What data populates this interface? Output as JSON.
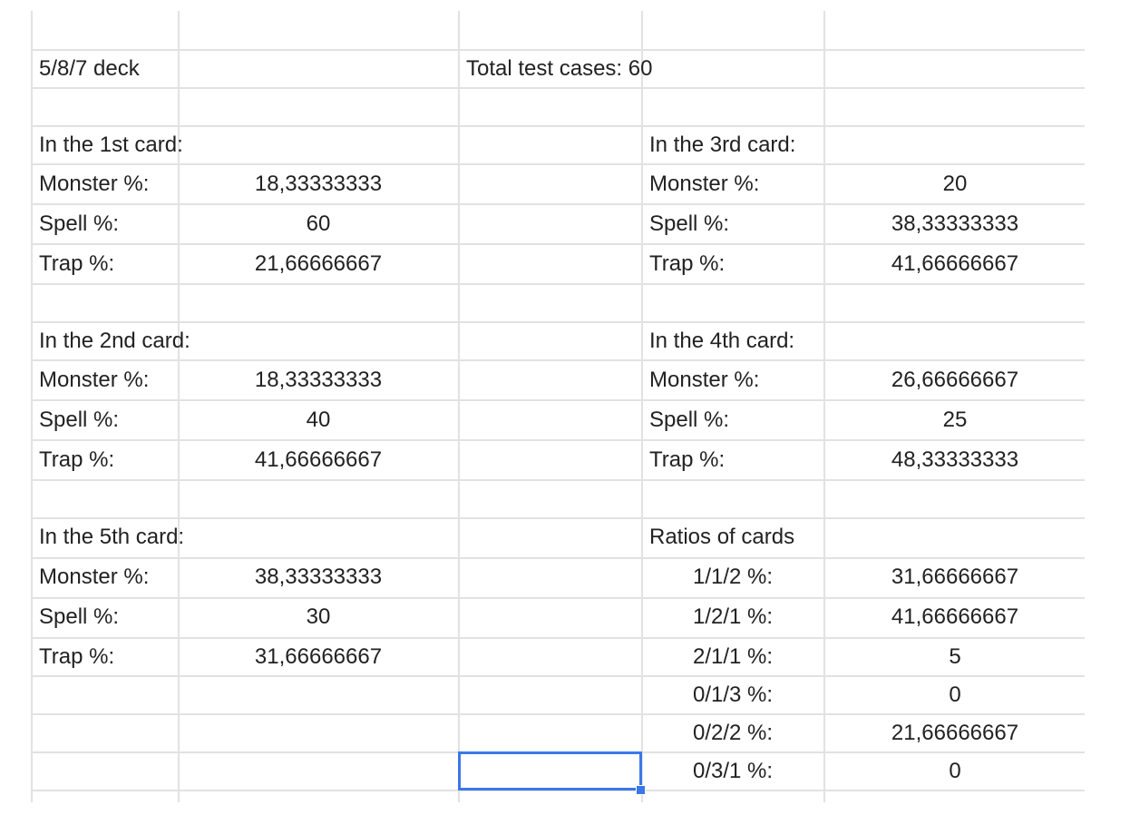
{
  "sheet": {
    "title": "5/8/7 deck",
    "total_test_cases": "Total test cases: 60",
    "labels": {
      "monster": "Monster %:",
      "spell": "Spell %:",
      "trap": "Trap %:"
    },
    "card1": {
      "heading": "In the 1st card:",
      "monster": "18,33333333",
      "spell": "60",
      "trap": "21,66666667"
    },
    "card2": {
      "heading": "In the 2nd card:",
      "monster": "18,33333333",
      "spell": "40",
      "trap": "41,66666667"
    },
    "card3": {
      "heading": "In the 3rd card:",
      "monster": "20",
      "spell": "38,33333333",
      "trap": "41,66666667"
    },
    "card4": {
      "heading": "In the 4th card:",
      "monster": "26,66666667",
      "spell": "25",
      "trap": "48,33333333"
    },
    "card5": {
      "heading": "In the 5th card:",
      "monster": "38,33333333",
      "spell": "30",
      "trap": "31,66666667"
    },
    "ratios": {
      "heading": "Ratios of cards",
      "rows": [
        {
          "label": "1/1/2 %:",
          "value": "31,66666667"
        },
        {
          "label": "1/2/1 %:",
          "value": "41,66666667"
        },
        {
          "label": "2/1/1 %:",
          "value": "5"
        },
        {
          "label": "0/1/3 %:",
          "value": "0"
        },
        {
          "label": "0/2/2 %:",
          "value": "21,66666667"
        },
        {
          "label": "0/3/1 %:",
          "value": "0"
        }
      ]
    }
  },
  "colors": {
    "gridline": "#e2e2e2",
    "selection": "#3b78e7",
    "text": "#222222"
  }
}
